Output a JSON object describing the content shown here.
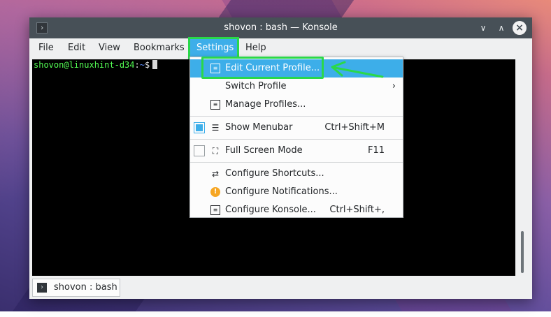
{
  "window": {
    "title": "shovon : bash — Konsole",
    "app_icon": "terminal-icon",
    "buttons": {
      "minimize": "chevron-down-icon",
      "maximize": "chevron-up-icon",
      "close": "close-icon"
    }
  },
  "menubar": {
    "items": [
      {
        "label": "File"
      },
      {
        "label": "Edit"
      },
      {
        "label": "View"
      },
      {
        "label": "Bookmarks"
      },
      {
        "label": "Settings",
        "active": true
      },
      {
        "label": "Help"
      }
    ]
  },
  "terminal": {
    "user_host": "shovon@linuxhint-d34",
    "separator": ":",
    "path": "~",
    "symbol": "$"
  },
  "settings_menu": {
    "items": [
      {
        "label": "Edit Current Profile...",
        "icon": "profile-icon",
        "highlighted": true
      },
      {
        "label": "Switch Profile",
        "submenu": true
      },
      {
        "label": "Manage Profiles...",
        "icon": "profile-icon"
      },
      {
        "label": "Show Menubar",
        "shortcut": "Ctrl+Shift+M",
        "checked": true
      },
      {
        "label": "Full Screen Mode",
        "shortcut": "F11",
        "checked": false
      },
      {
        "label": "Configure Shortcuts...",
        "icon": "shortcuts-icon"
      },
      {
        "label": "Configure Notifications...",
        "icon": "bell-icon"
      },
      {
        "label": "Configure Konsole...",
        "shortcut": "Ctrl+Shift+,",
        "icon": "settings-icon"
      }
    ]
  },
  "tabbar": {
    "tabs": [
      {
        "label": "shovon : bash"
      }
    ]
  },
  "colors": {
    "accent": "#3daee9",
    "annotation": "#2ad84a",
    "titlebar": "#475057",
    "prompt_user": "#54ff54",
    "prompt_path": "#5f8fff"
  }
}
